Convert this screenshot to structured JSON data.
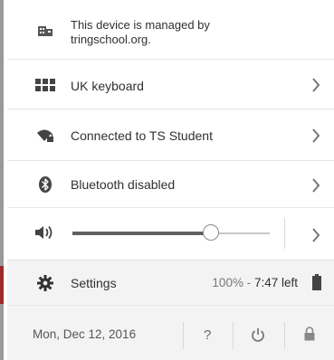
{
  "managed": {
    "text_line1": "This device is managed by",
    "text_line2": "tringschool.org.",
    "icon": "building-icon"
  },
  "keyboard": {
    "label": "UK keyboard",
    "icon": "keyboard-icon"
  },
  "network": {
    "label": "Connected to TS Student",
    "icon": "wifi-lock-icon"
  },
  "bluetooth": {
    "label": "Bluetooth disabled",
    "icon": "bluetooth-icon"
  },
  "volume": {
    "level": 0.7,
    "icon": "volume-icon"
  },
  "settings": {
    "label": "Settings",
    "battery_percent": "100% - ",
    "battery_time": "7:47 left",
    "icon": "gear-icon",
    "battery_icon": "battery-icon"
  },
  "footer": {
    "date": "Mon, Dec 12, 2016",
    "help_label": "?",
    "power_icon": "power-icon",
    "lock_icon": "lock-icon"
  },
  "colors": {
    "accent_left_bar": "#9e2a2a",
    "slider_filled": "#606060",
    "slider_empty": "#c8c8c8"
  }
}
